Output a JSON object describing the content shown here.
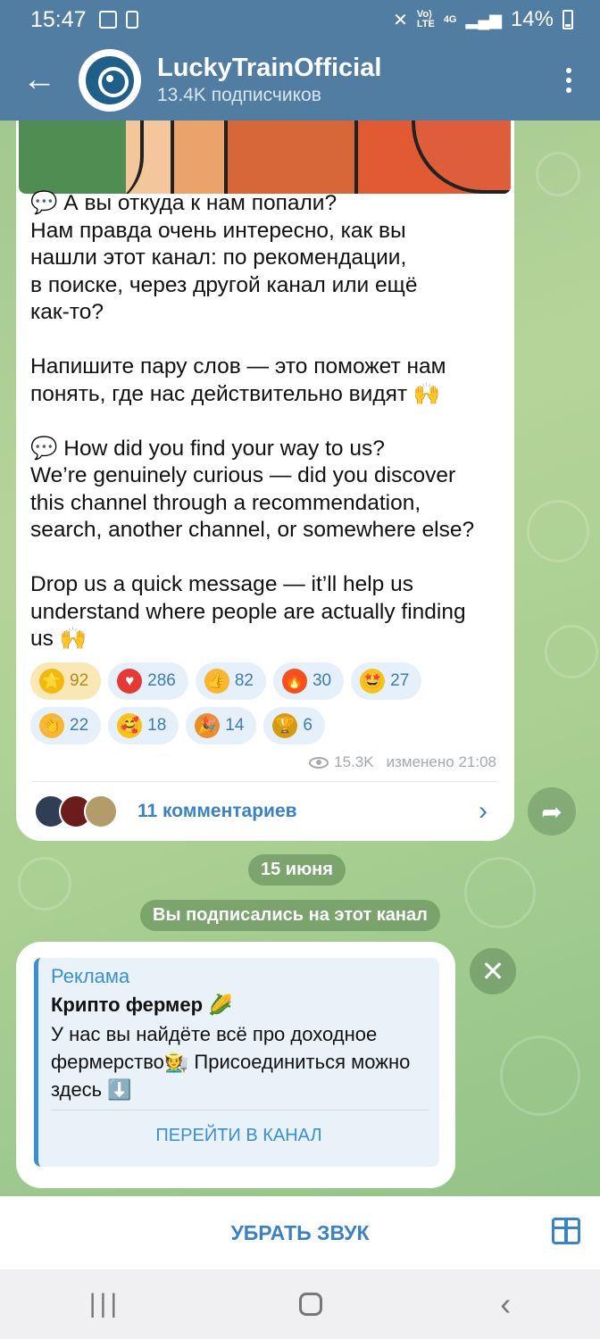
{
  "status": {
    "time": "15:47",
    "net_top": "Vo)",
    "net_bottom": "LTE",
    "g_top": "4G",
    "battery": "14%"
  },
  "header": {
    "channel_name": "LuckyTrainOfficial",
    "subscribers": "13.4K подписчиков"
  },
  "post": {
    "text": "💬 А вы откуда к нам попали?\nНам правда очень интересно, как вы\nнашли этот канал: по рекомендации,\nв поиске, через другой канал или ещё\nкак-то?\n\nНапишите пару слов — это поможет нам\nпонять, где нас действительно видят 🙌\n\n💬 How did you find your way to us?\nWe’re genuinely curious — did you discover\nthis channel through a recommendation,\nsearch, another channel, or somewhere else?\n\nDrop us a quick message — it’ll help us\nunderstand where people are actually finding\nus 🙌",
    "reactions_row1": [
      {
        "emoji": "⭐",
        "count": "92",
        "color": "#f3b80f"
      },
      {
        "emoji": "♥",
        "count": "286",
        "color": "#e53935"
      },
      {
        "emoji": "👍",
        "count": "82",
        "color": "#f7b733"
      },
      {
        "emoji": "🔥",
        "count": "30",
        "color": "#f4511e"
      },
      {
        "emoji": "🤩",
        "count": "27",
        "color": "#f7c21b"
      }
    ],
    "reactions_row2": [
      {
        "emoji": "👏",
        "count": "22",
        "color": "#f7b733"
      },
      {
        "emoji": "🥰",
        "count": "18",
        "color": "#f7c21b"
      },
      {
        "emoji": "🎉",
        "count": "14",
        "color": "#e98d2c"
      },
      {
        "emoji": "🏆",
        "count": "6",
        "color": "#d69a12"
      }
    ],
    "views": "15.3K",
    "edited": "изменено 21:08",
    "comments": "11 комментариев"
  },
  "date_pill": "15 июня",
  "service_pill": "Вы подписались на этот канал",
  "ad": {
    "label": "Реклама",
    "title": "Крипто фермер 🌽",
    "body": "У нас вы найдёте всё про доходное фермерство🧑‍🌾 Присоединиться можно здесь ⬇️",
    "button": "ПЕРЕЙТИ В КАНАЛ"
  },
  "bottom": {
    "mute": "УБРАТЬ ЗВУК"
  },
  "icons": {
    "back": "arrow-left-icon",
    "menu": "more-vertical-icon",
    "share": "share-arrow-icon",
    "close": "close-icon",
    "gift": "gift-icon"
  }
}
